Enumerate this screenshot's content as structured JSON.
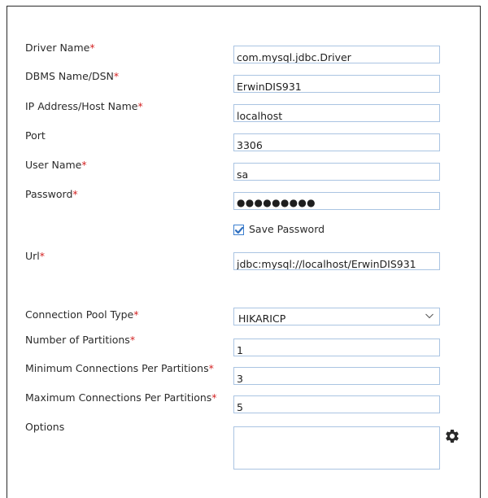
{
  "form": {
    "required_mark": "*",
    "driver_name": {
      "label": "Driver Name",
      "value": "com.mysql.jdbc.Driver"
    },
    "dbms_name": {
      "label": "DBMS Name/DSN",
      "value": "ErwinDIS931"
    },
    "ip_address": {
      "label": "IP Address/Host Name",
      "value": "localhost"
    },
    "port": {
      "label": "Port",
      "value": "3306"
    },
    "user_name": {
      "label": "User Name",
      "value": "sa"
    },
    "password": {
      "label": "Password",
      "value": "●●●●●●●●●"
    },
    "save_password": {
      "label": "Save Password",
      "checked": true
    },
    "url": {
      "label": "Url",
      "value": "jdbc:mysql://localhost/ErwinDIS931"
    },
    "connection_pool_type": {
      "label": "Connection Pool Type",
      "value": "HIKARICP"
    },
    "number_of_partitions": {
      "label": "Number of Partitions",
      "value": "1"
    },
    "min_connections": {
      "label": "Minimum Connections Per Partitions",
      "value": "3"
    },
    "max_connections": {
      "label": "Maximum Connections Per Partitions",
      "value": "5"
    },
    "options": {
      "label": "Options",
      "value": ""
    }
  },
  "icons": {
    "options_button": "gear-icon",
    "dropdown": "chevron-down-icon",
    "checkbox": "checkmark-icon"
  },
  "colors": {
    "required": "#d32323",
    "field_border": "#aac4e2",
    "checkbox": "#3b7fd0"
  }
}
